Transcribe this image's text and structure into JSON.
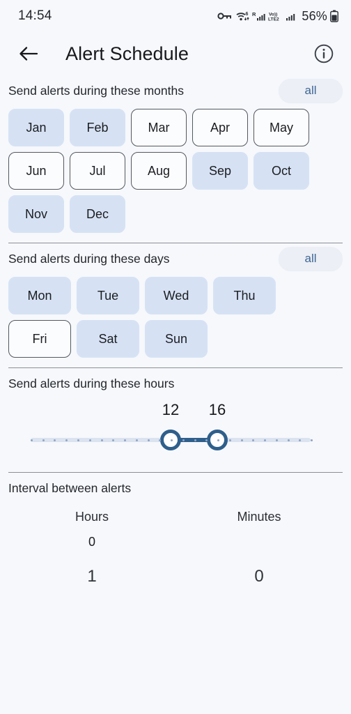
{
  "statusbar": {
    "clock": "14:54",
    "icons": [
      "vpn-key-icon",
      "wifi-6-icon",
      "signal-roaming-icon",
      "volte-lte2-icon",
      "signal-bars-icon"
    ],
    "wifi_gen": "6",
    "roaming_label": "R",
    "volte_label": "Vo))",
    "lte_label": "LTE2",
    "battery": "56%"
  },
  "appbar": {
    "back_icon": "back-arrow-icon",
    "title": "Alert Schedule",
    "info_icon": "info-icon"
  },
  "months_section": {
    "label": "Send alerts during these months",
    "all_label": "all",
    "chips": [
      {
        "label": "Jan",
        "selected": true
      },
      {
        "label": "Feb",
        "selected": true
      },
      {
        "label": "Mar",
        "selected": false
      },
      {
        "label": "Apr",
        "selected": false
      },
      {
        "label": "May",
        "selected": false
      },
      {
        "label": "Jun",
        "selected": false
      },
      {
        "label": "Jul",
        "selected": false
      },
      {
        "label": "Aug",
        "selected": false
      },
      {
        "label": "Sep",
        "selected": true
      },
      {
        "label": "Oct",
        "selected": true
      },
      {
        "label": "Nov",
        "selected": true
      },
      {
        "label": "Dec",
        "selected": true
      }
    ]
  },
  "days_section": {
    "label": "Send alerts during these days",
    "all_label": "all",
    "chips": [
      {
        "label": "Mon",
        "selected": true
      },
      {
        "label": "Tue",
        "selected": true
      },
      {
        "label": "Wed",
        "selected": true
      },
      {
        "label": "Thu",
        "selected": true
      },
      {
        "label": "Fri",
        "selected": false
      },
      {
        "label": "Sat",
        "selected": true
      },
      {
        "label": "Sun",
        "selected": true
      }
    ]
  },
  "hours_section": {
    "label": "Send alerts during these hours",
    "min": 0,
    "max": 24,
    "start": 12,
    "end": 16,
    "start_label": "12",
    "end_label": "16",
    "tick_count": 25
  },
  "interval_section": {
    "label": "Interval between alerts",
    "hours_label": "Hours",
    "minutes_label": "Minutes",
    "hours_items": [
      "0",
      "1"
    ],
    "minutes_items": [
      "",
      "0"
    ]
  },
  "colors": {
    "page_bg": "#f6f8fc",
    "chip_selected_bg": "#d6e2f4",
    "chip_border": "#53585f",
    "accent_blue": "#2f5f8b",
    "pill_text": "#3f6694",
    "pill_bg": "#eceff6"
  }
}
